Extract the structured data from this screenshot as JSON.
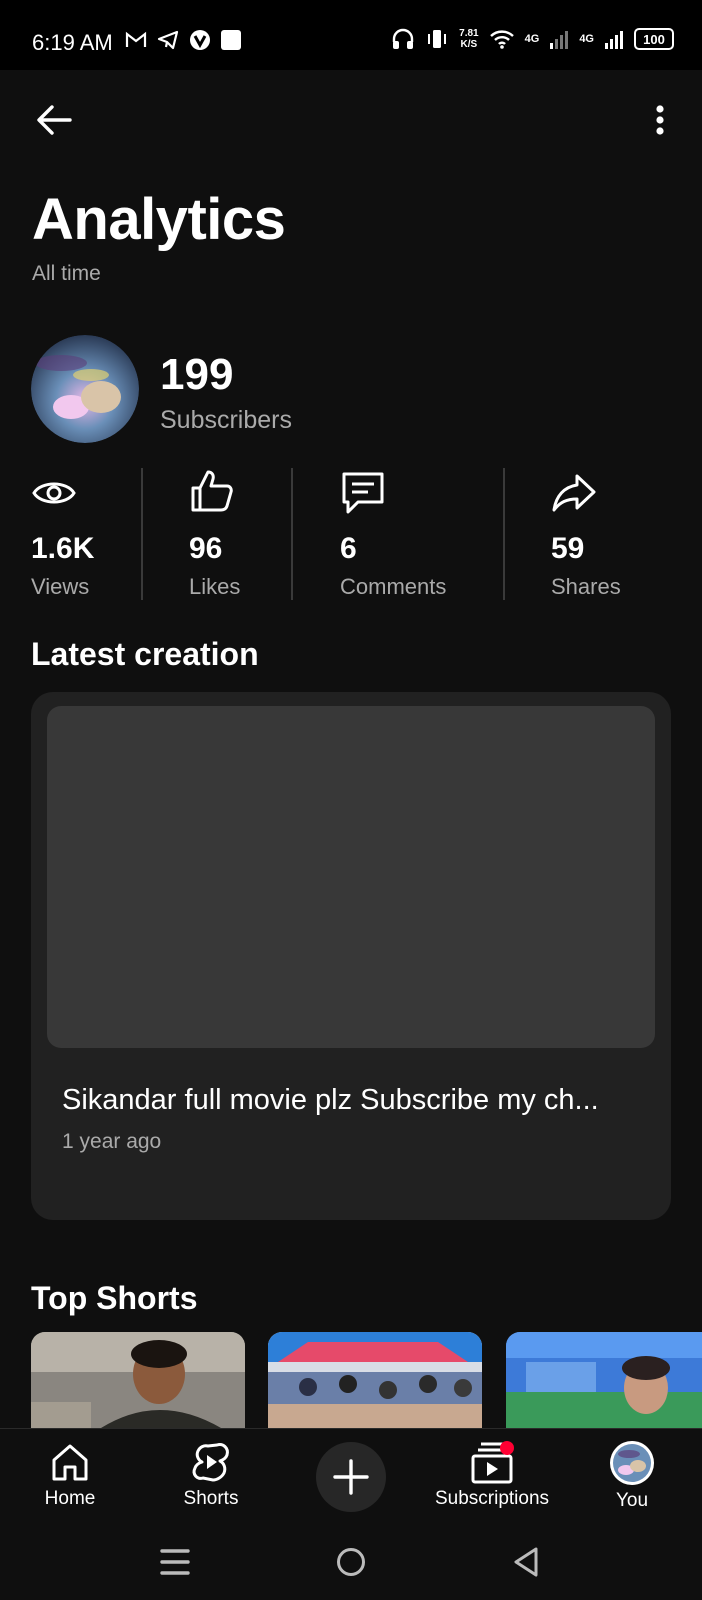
{
  "status_bar": {
    "time": "6:19 AM",
    "speed_value": "7.81",
    "speed_unit": "K/S",
    "network_1": "4G",
    "network_2": "4G",
    "battery": "100",
    "left_icons": [
      "gmail-icon",
      "telegram-icon",
      "vpn-icon",
      "square-icon"
    ],
    "right_icons": [
      "headphones-icon",
      "vibrate-icon",
      "wifi-icon",
      "signal-icon"
    ]
  },
  "header": {
    "title": "Analytics",
    "period": "All time"
  },
  "channel": {
    "subscriber_count": "199",
    "subscriber_label": "Subscribers"
  },
  "stats": [
    {
      "icon": "eye-icon",
      "value": "1.6K",
      "label": "Views"
    },
    {
      "icon": "thumbs-up-icon",
      "value": "96",
      "label": "Likes"
    },
    {
      "icon": "comment-icon",
      "value": "6",
      "label": "Comments"
    },
    {
      "icon": "share-icon",
      "value": "59",
      "label": "Shares"
    }
  ],
  "latest_creation": {
    "section_title": "Latest creation",
    "video_title": "Sikandar full movie plz Subscribe my ch...",
    "age": "1 year ago"
  },
  "top_shorts": {
    "section_title": "Top Shorts"
  },
  "bottom_nav": {
    "items": [
      {
        "label": "Home",
        "icon": "home-icon"
      },
      {
        "label": "Shorts",
        "icon": "shorts-icon"
      },
      {
        "label": "",
        "icon": "plus-icon"
      },
      {
        "label": "Subscriptions",
        "icon": "subscriptions-icon"
      },
      {
        "label": "You",
        "icon": "profile-avatar"
      }
    ]
  },
  "colors": {
    "background": "#0f0f0f",
    "card": "#212121",
    "notification_dot": "#ff0033",
    "secondary_text": "#aaaaaa"
  }
}
